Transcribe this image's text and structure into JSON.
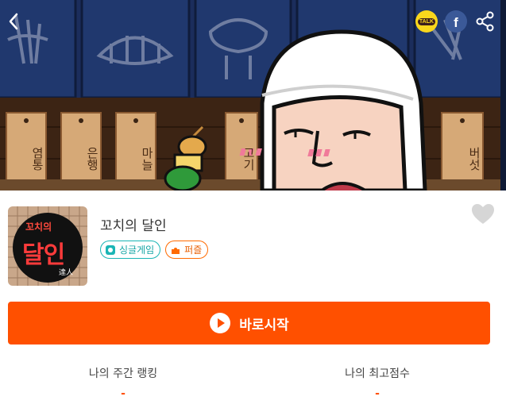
{
  "header": {
    "back_icon": "chevron-left-icon",
    "share": {
      "kakao_label": "TALK",
      "facebook_label": "f",
      "share_icon": "share-nodes-icon"
    }
  },
  "banner": {
    "signs": [
      "염통",
      "은행",
      "마늘",
      "고기",
      "버섯"
    ]
  },
  "game": {
    "thumbnail_text_top": "꼬치의",
    "thumbnail_text_main": "달인",
    "thumbnail_text_hanja": "達人",
    "title": "꼬치의 달인",
    "tags": [
      {
        "label": "싱글게임",
        "icon": "single-game-icon",
        "color": "#1ab5b5"
      },
      {
        "label": "퍼즐",
        "icon": "puzzle-icon",
        "color": "#ff6a00"
      }
    ],
    "favorite_icon": "heart-icon"
  },
  "play": {
    "label": "바로시작",
    "icon": "play-circle-icon",
    "color": "#ff5000"
  },
  "stats": {
    "weekly_rank_label": "나의 주간 랭킹",
    "weekly_rank_value": "-",
    "best_score_label": "나의 최고점수",
    "best_score_value": "-"
  }
}
